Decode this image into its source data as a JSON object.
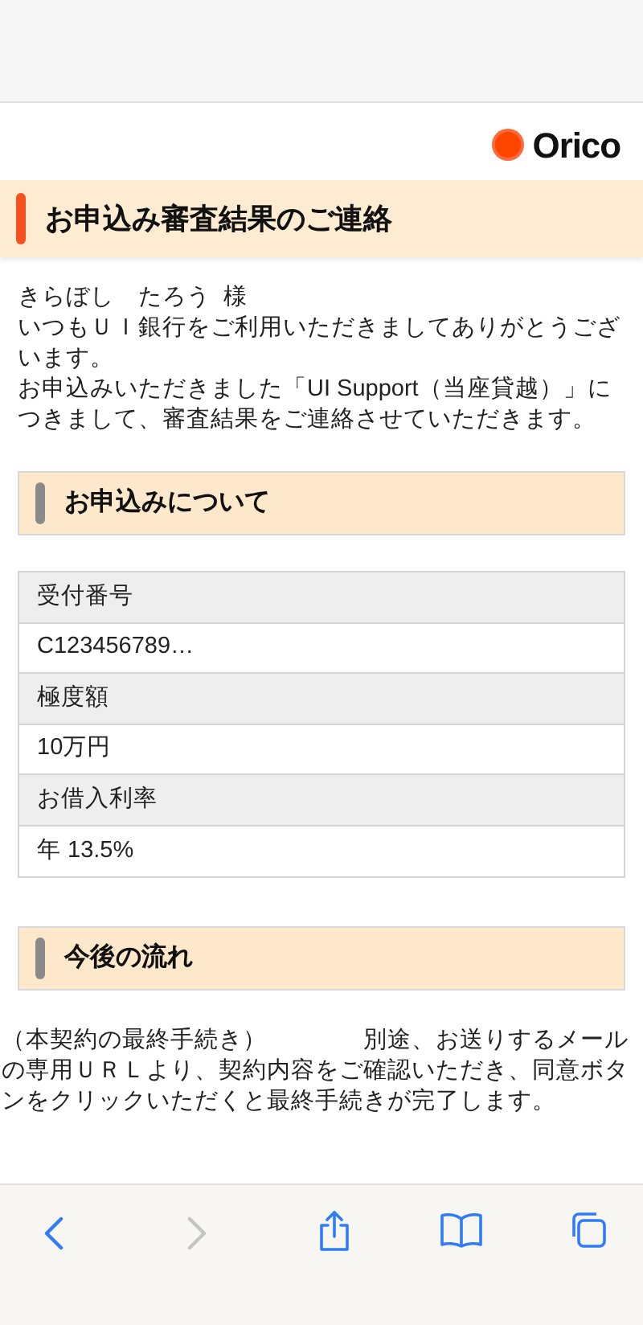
{
  "header": {
    "logo": "Orico"
  },
  "title": "お申込み審査結果のご連絡",
  "greeting": [
    "きらぼし　たろう  様",
    "いつもＵＩ銀行をご利用いただきましてありがとうございます。",
    "お申込みいただきました「UI Support（当座貸越）」につきまして、審査結果をご連絡させていただきます。"
  ],
  "sections": [
    {
      "heading": "お申込みについて",
      "kind": "table",
      "rows": [
        {
          "label": "受付番号",
          "value": "C123456789…"
        },
        {
          "label": "極度額",
          "value": "10万円"
        },
        {
          "label": "お借入利率",
          "value": "年 13.5%"
        }
      ]
    },
    {
      "heading": "今後の流れ",
      "kind": "text",
      "text": "（本契約の最終手続き）　　　　別途、お送りするメールの専用ＵＲＬより、契約内容をご確認いただき、同意ボタンをクリックいただくと最終手続きが完了します。"
    }
  ],
  "toolbar": {
    "back_disabled": false,
    "forward_disabled": true
  }
}
